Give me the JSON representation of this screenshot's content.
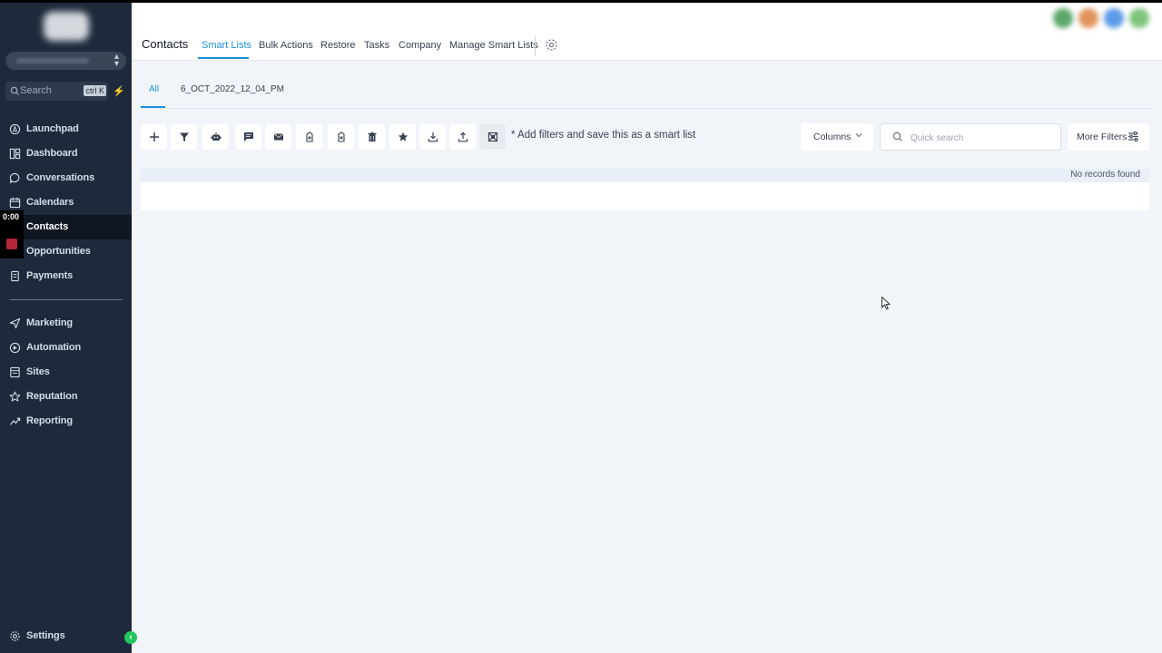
{
  "sidebar": {
    "search": {
      "label": "Search",
      "shortcut": "ctrl K"
    },
    "items": [
      {
        "label": "Launchpad",
        "icon": "launchpad-icon"
      },
      {
        "label": "Dashboard",
        "icon": "dashboard-icon"
      },
      {
        "label": "Conversations",
        "icon": "chat-icon"
      },
      {
        "label": "Calendars",
        "icon": "calendar-icon"
      },
      {
        "label": "Contacts",
        "icon": "contacts-icon",
        "active": true
      },
      {
        "label": "Opportunities",
        "icon": "opportunities-icon"
      },
      {
        "label": "Payments",
        "icon": "payments-icon"
      }
    ],
    "items2": [
      {
        "label": "Marketing",
        "icon": "send-icon"
      },
      {
        "label": "Automation",
        "icon": "automation-icon"
      },
      {
        "label": "Sites",
        "icon": "sites-icon"
      },
      {
        "label": "Reputation",
        "icon": "star-icon"
      },
      {
        "label": "Reporting",
        "icon": "trend-icon"
      }
    ],
    "settings": {
      "label": "Settings",
      "icon": "gear-icon"
    },
    "timer": "0:00"
  },
  "header": {
    "title": "Contacts",
    "tabs": [
      {
        "label": "Smart Lists",
        "active": true
      },
      {
        "label": "Bulk Actions"
      },
      {
        "label": "Restore"
      },
      {
        "label": "Tasks"
      },
      {
        "label": "Company"
      },
      {
        "label": "Manage Smart Lists"
      }
    ]
  },
  "smartlists": {
    "tabs": [
      {
        "label": "All",
        "active": true
      },
      {
        "label": "6_OCT_2022_12_04_PM"
      }
    ]
  },
  "toolbar": {
    "hint": "* Add filters and save this as a smart list",
    "columns_label": "Columns",
    "search_placeholder": "Quick search",
    "more_filters_label": "More Filters"
  },
  "table": {
    "empty_text": "No records found"
  },
  "colors": {
    "sidebar_bg": "#1e2a3b",
    "accent": "#1d8fdb",
    "success": "#22c55e"
  }
}
